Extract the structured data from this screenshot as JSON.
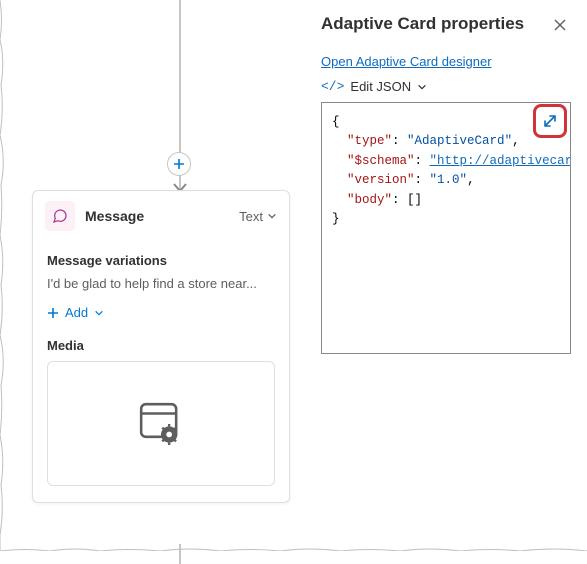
{
  "canvas": {
    "card": {
      "title": "Message",
      "type_label": "Text",
      "variations_label": "Message variations",
      "variation_preview": "I'd be glad to help find a store near...",
      "add_label": "Add",
      "media_label": "Media"
    }
  },
  "panel": {
    "title": "Adaptive Card properties",
    "designer_link": "Open Adaptive Card designer",
    "edit_json_label": "Edit JSON",
    "json": {
      "type_key": "\"type\"",
      "type_val": "\"AdaptiveCard\"",
      "schema_key": "\"$schema\"",
      "schema_val": "\"http://adaptivecards.i",
      "version_key": "\"version\"",
      "version_val": "\"1.0\"",
      "body_key": "\"body\"",
      "body_val": "[]"
    }
  }
}
